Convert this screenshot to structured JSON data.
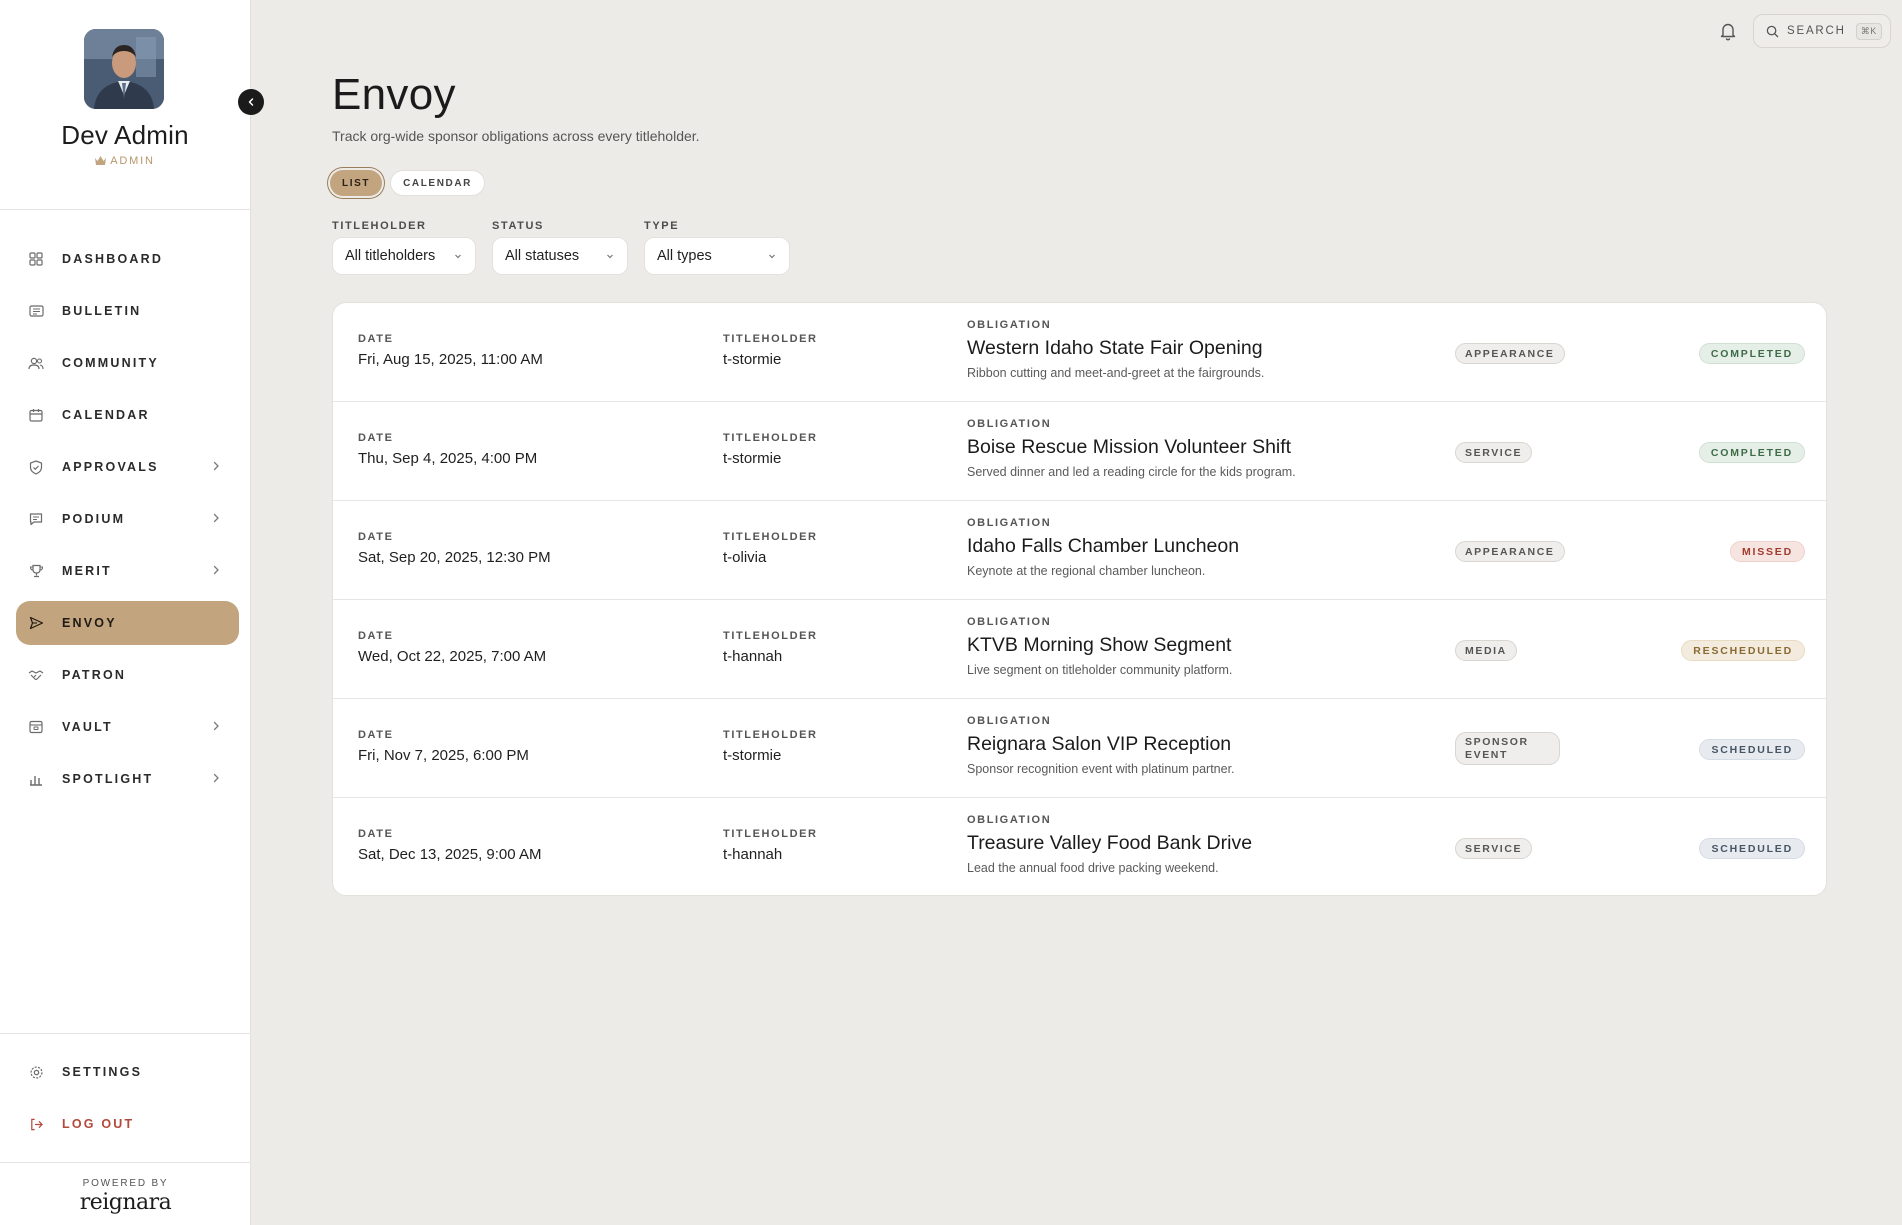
{
  "profile": {
    "name": "Dev Admin",
    "role": "ADMIN"
  },
  "nav": {
    "items": [
      {
        "label": "DASHBOARD",
        "icon": "grid-icon",
        "chevron": false
      },
      {
        "label": "BULLETIN",
        "icon": "newspaper-icon",
        "chevron": false
      },
      {
        "label": "COMMUNITY",
        "icon": "users-icon",
        "chevron": false
      },
      {
        "label": "CALENDAR",
        "icon": "calendar-icon",
        "chevron": false
      },
      {
        "label": "APPROVALS",
        "icon": "shield-check-icon",
        "chevron": true
      },
      {
        "label": "PODIUM",
        "icon": "message-icon",
        "chevron": true
      },
      {
        "label": "MERIT",
        "icon": "trophy-icon",
        "chevron": true
      },
      {
        "label": "ENVOY",
        "icon": "send-icon",
        "chevron": false,
        "active": true
      },
      {
        "label": "PATRON",
        "icon": "handshake-icon",
        "chevron": false
      },
      {
        "label": "VAULT",
        "icon": "vault-icon",
        "chevron": true
      },
      {
        "label": "SPOTLIGHT",
        "icon": "bar-chart-icon",
        "chevron": true
      }
    ],
    "settings": "SETTINGS",
    "logout": "LOG OUT"
  },
  "footer": {
    "powered_by": "POWERED BY",
    "brand": "reignara"
  },
  "topbar": {
    "search_label": "SEARCH",
    "search_shortcut": "⌘K"
  },
  "header": {
    "title": "Envoy",
    "subtitle": "Track org-wide sponsor obligations across every titleholder."
  },
  "view_toggle": {
    "list": "LIST",
    "calendar": "CALENDAR",
    "active": "list"
  },
  "filters": {
    "titleholder": {
      "label": "TITLEHOLDER",
      "value": "All titleholders"
    },
    "status": {
      "label": "STATUS",
      "value": "All statuses"
    },
    "type": {
      "label": "TYPE",
      "value": "All types"
    }
  },
  "table": {
    "labels": {
      "date": "DATE",
      "titleholder": "TITLEHOLDER",
      "obligation": "OBLIGATION"
    },
    "rows": [
      {
        "date": "Fri, Aug 15, 2025, 11:00 AM",
        "titleholder": "t-stormie",
        "title": "Western Idaho State Fair Opening",
        "desc": "Ribbon cutting and meet-and-greet at the fairgrounds.",
        "type": "APPEARANCE",
        "status": "COMPLETED"
      },
      {
        "date": "Thu, Sep 4, 2025, 4:00 PM",
        "titleholder": "t-stormie",
        "title": "Boise Rescue Mission Volunteer Shift",
        "desc": "Served dinner and led a reading circle for the kids program.",
        "type": "SERVICE",
        "status": "COMPLETED"
      },
      {
        "date": "Sat, Sep 20, 2025, 12:30 PM",
        "titleholder": "t-olivia",
        "title": "Idaho Falls Chamber Luncheon",
        "desc": "Keynote at the regional chamber luncheon.",
        "type": "APPEARANCE",
        "status": "MISSED"
      },
      {
        "date": "Wed, Oct 22, 2025, 7:00 AM",
        "titleholder": "t-hannah",
        "title": "KTVB Morning Show Segment",
        "desc": "Live segment on titleholder community platform.",
        "type": "MEDIA",
        "status": "RESCHEDULED"
      },
      {
        "date": "Fri, Nov 7, 2025, 6:00 PM",
        "titleholder": "t-stormie",
        "title": "Reignara Salon VIP Reception",
        "desc": "Sponsor recognition event with platinum partner.",
        "type": "SPONSOR EVENT",
        "status": "SCHEDULED"
      },
      {
        "date": "Sat, Dec 13, 2025, 9:00 AM",
        "titleholder": "t-hannah",
        "title": "Treasure Valley Food Bank Drive",
        "desc": "Lead the annual food drive packing weekend.",
        "type": "SERVICE",
        "status": "SCHEDULED"
      }
    ]
  },
  "status_colors": {
    "COMPLETED": {
      "bg": "#e6efe7",
      "fg": "#3d6b48",
      "border": "#cfe0d2"
    },
    "MISSED": {
      "bg": "#f6e4e1",
      "fg": "#a23b2f",
      "border": "#efd2cd"
    },
    "RESCHEDULED": {
      "bg": "#f3ebdd",
      "fg": "#8a6a33",
      "border": "#e8dbc3"
    },
    "SCHEDULED": {
      "bg": "#e7ebef",
      "fg": "#475565",
      "border": "#d5dce3"
    }
  },
  "colors": {
    "accent": "#c2a47e",
    "background": "#edebe8",
    "danger": "#b4483b"
  }
}
